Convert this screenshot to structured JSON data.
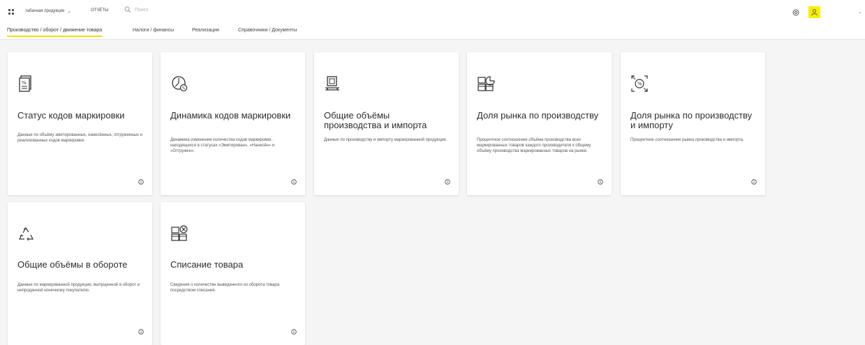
{
  "header": {
    "product_label": "табачная продукция",
    "reports_label": "ОТЧЁТЫ",
    "search_placeholder": "Поиск"
  },
  "tabs": [
    {
      "label": "Производство / оборот / движение товара",
      "active": true
    },
    {
      "label": "Налоги / финансы",
      "active": false
    },
    {
      "label": "Реализация",
      "active": false
    },
    {
      "label": "Справочники / Документы",
      "active": false
    }
  ],
  "cards": [
    {
      "title": "Статус кодов маркировки",
      "desc": "Данные по объёму эмитированных, нанесённых, отгруженных и реализованных кодов маркировки.",
      "icon": "document-code-icon"
    },
    {
      "title": "Динамика кодов маркировки",
      "desc": "Динамика изменения количества кодов маркировки, находящихся в статусах «Эмитирован», «Нанесён» и «Отгружен».",
      "icon": "clock-chart-icon"
    },
    {
      "title": "Общие объёмы производства и импорта",
      "desc": "Данные по производству и импорту маркированной продукции.",
      "icon": "conveyor-icon"
    },
    {
      "title": "Доля рынка по производству",
      "desc": "Процентное соотношение объёма производства всех маркированных товаров каждого производителя к общему объёму производства маркированных товаров на рынке.",
      "icon": "boxes-pie-icon"
    },
    {
      "title": "Доля рынка по производству и импорту",
      "desc": "Процентное соотношение рынка производства и импорта.",
      "icon": "expand-percent-icon"
    },
    {
      "title": "Общие объёмы в обороте",
      "desc": "Данные по маркированной продукции, выпущенной в оборот и непроданной конечному покупателю.",
      "icon": "recycle-icon"
    },
    {
      "title": "Списание товара",
      "desc": "Сведения о количестве выведенного из оборота товара посредством списания.",
      "icon": "boxes-cancel-icon"
    }
  ],
  "colors": {
    "accent": "#f6f000",
    "background": "#f5f5f5"
  }
}
